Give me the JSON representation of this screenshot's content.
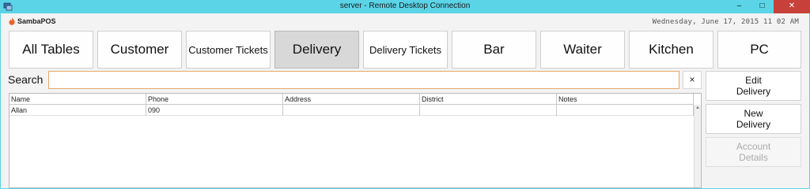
{
  "window": {
    "title": "server - Remote Desktop Connection",
    "controls": {
      "minimize": "–",
      "maximize": "□",
      "close": "✕"
    }
  },
  "header": {
    "logo_text": "SambaPOS",
    "datetime": "Wednesday, June 17, 2015 11 02 AM"
  },
  "nav": {
    "items": [
      {
        "label": "All Tables"
      },
      {
        "label": "Customer"
      },
      {
        "label": "Customer Tickets"
      },
      {
        "label": "Delivery",
        "active": true
      },
      {
        "label": "Delivery Tickets"
      },
      {
        "label": "Bar"
      },
      {
        "label": "Waiter"
      },
      {
        "label": "Kitchen"
      },
      {
        "label": "PC"
      }
    ]
  },
  "search": {
    "label": "Search",
    "value": "",
    "clear_label": "×"
  },
  "table": {
    "columns": [
      "Name",
      "Phone",
      "Address",
      "District",
      "Notes"
    ],
    "rows": [
      [
        "Allan",
        "090",
        "",
        "",
        ""
      ]
    ]
  },
  "actions": {
    "edit_delivery": {
      "line1": "Edit",
      "line2": "Delivery"
    },
    "new_delivery": {
      "line1": "New",
      "line2": "Delivery"
    },
    "account_details": {
      "line1": "Account",
      "line2": "Details",
      "disabled": true
    }
  },
  "colors": {
    "window_border": "#5ad4e6",
    "close_button": "#c7413a",
    "search_border": "#e8a76a",
    "logo_flame": "#e8642a",
    "active_tab": "#d8d8d8"
  }
}
